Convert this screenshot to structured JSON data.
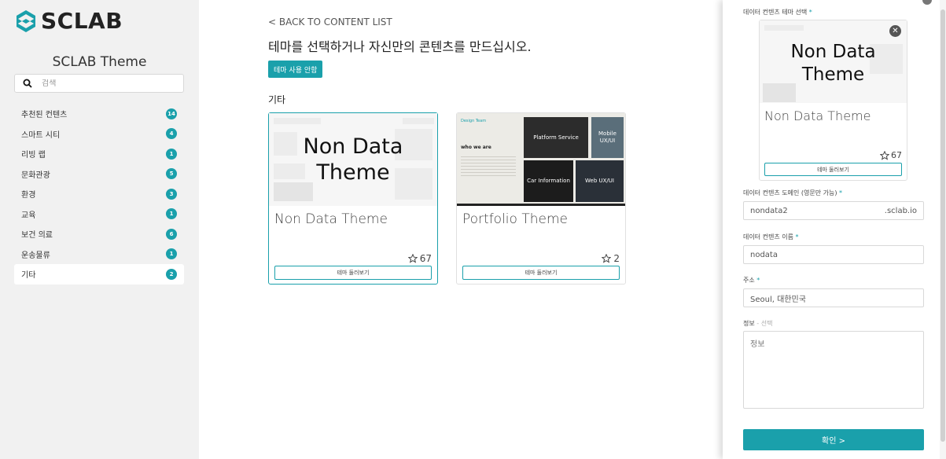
{
  "sidebar": {
    "logo_text": "SCLAB",
    "title": "SCLAB Theme",
    "search_placeholder": "검색",
    "categories": [
      {
        "label": "추천된 컨텐츠",
        "count": "14"
      },
      {
        "label": "스마트 시티",
        "count": "4"
      },
      {
        "label": "리빙 랩",
        "count": "1"
      },
      {
        "label": "문화관광",
        "count": "5"
      },
      {
        "label": "환경",
        "count": "3"
      },
      {
        "label": "교육",
        "count": "1"
      },
      {
        "label": "보건 의료",
        "count": "6"
      },
      {
        "label": "운송물류",
        "count": "1"
      },
      {
        "label": "기타",
        "count": "2",
        "active": true
      }
    ]
  },
  "main": {
    "back_link": "< BACK TO CONTENT LIST",
    "headline": "테마를 선택하거나 자신만의 콘텐츠를 만드십시오.",
    "guide_button": "테마 사용 안함",
    "section_label": "기타",
    "cards": [
      {
        "thumb_text": "Non Data Theme",
        "name": "Non Data Theme",
        "stars": "67",
        "preview": "테마 둘러보기",
        "selected": true
      },
      {
        "name": "Portfolio Theme",
        "stars": "2",
        "preview": "테마 둘러보기",
        "selected": false,
        "thumb_tiles": [
          "Platform Service",
          "Mobile UX/UI",
          "Car Information",
          "Web UX/UI"
        ],
        "thumb_caption": "who we are",
        "thumb_brand": "Design Team"
      }
    ]
  },
  "panel": {
    "theme_label": "데이터 컨텐츠 테마 선택",
    "selected_card": {
      "thumb_text": "Non Data Theme",
      "name": "Non Data Theme",
      "stars": "67",
      "preview": "테마 둘러보기"
    },
    "domain_label": "데이터 컨텐츠 도메인 (영문만 가능)",
    "domain_value": "nondata2",
    "domain_suffix": ".sclab.io",
    "name_label": "데이터 컨텐츠 이름",
    "name_value": "nodata",
    "address_label": "주소",
    "address_value": "Seoul, 대한민국",
    "info_label": "정보",
    "info_optional": "- 선택",
    "info_placeholder": "정보",
    "confirm_button": "확인 >",
    "required_mark": "*"
  },
  "colors": {
    "accent": "#1aa0ab",
    "sidebar_bg": "#f1f1f1"
  },
  "icons": [
    "search-icon",
    "star-icon",
    "close-icon",
    "logo-icon"
  ]
}
